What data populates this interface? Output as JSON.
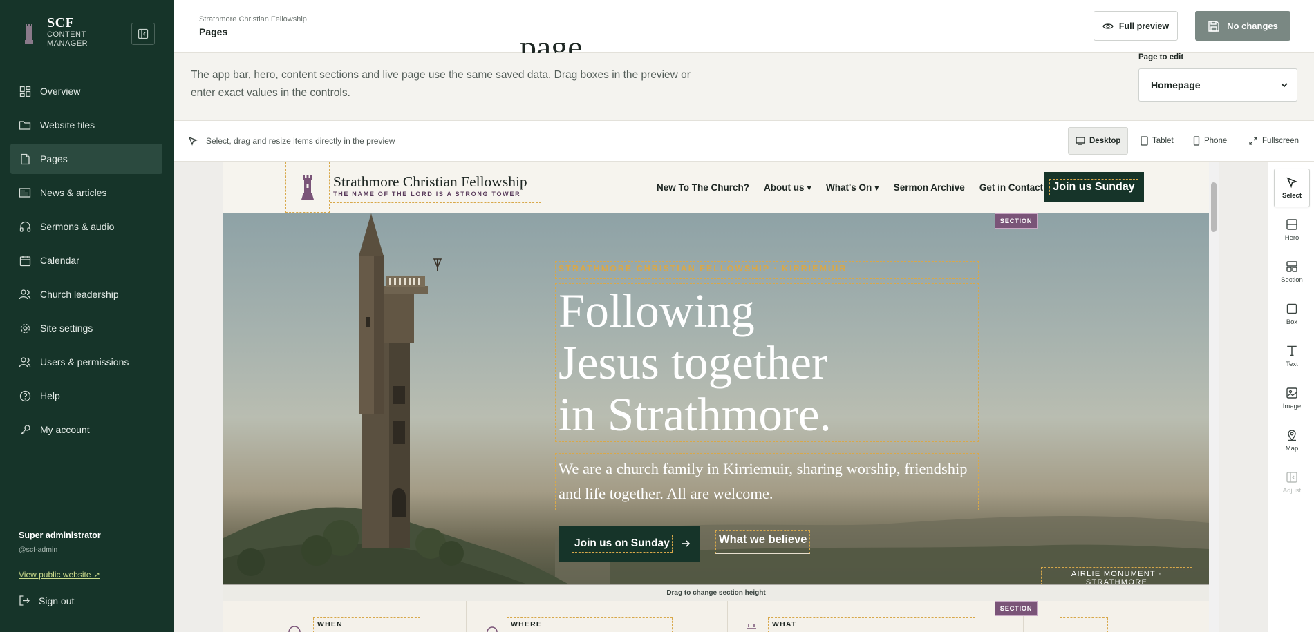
{
  "sidebar": {
    "brand_title": "SCF",
    "brand_sub1": "CONTENT",
    "brand_sub2": "MANAGER",
    "items": [
      {
        "label": "Overview",
        "icon": "dashboard-icon"
      },
      {
        "label": "Website files",
        "icon": "folder-icon"
      },
      {
        "label": "Pages",
        "icon": "file-icon",
        "active": true
      },
      {
        "label": "News & articles",
        "icon": "newspaper-icon"
      },
      {
        "label": "Sermons & audio",
        "icon": "headphones-icon"
      },
      {
        "label": "Calendar",
        "icon": "calendar-icon"
      },
      {
        "label": "Church leadership",
        "icon": "users-icon"
      },
      {
        "label": "Site settings",
        "icon": "gear-icon"
      },
      {
        "label": "Users & permissions",
        "icon": "user-group-icon"
      },
      {
        "label": "Help",
        "icon": "help-icon"
      },
      {
        "label": "My account",
        "icon": "key-icon"
      }
    ],
    "user_role": "Super administrator",
    "user_handle": "@scf-admin",
    "public_link": "View public website ↗",
    "sign_out": "Sign out"
  },
  "topbar": {
    "breadcrumb": "Strathmore Christian Fellowship",
    "title": "Pages",
    "ghost_heading": "page",
    "full_preview": "Full preview",
    "no_changes": "No changes"
  },
  "intro": {
    "text": "The app bar, hero, content sections and live page use the same saved data. Drag boxes in the preview or enter exact values in the controls.",
    "page_label": "Page to edit",
    "page_value": "Homepage"
  },
  "toolbar": {
    "hint": "Select, drag and resize items directly in the preview",
    "devices": [
      "Desktop",
      "Tablet",
      "Phone",
      "Fullscreen"
    ],
    "active_device": "Desktop"
  },
  "rail": {
    "tools": [
      {
        "label": "Select",
        "icon": "cursor-icon",
        "state": "active"
      },
      {
        "label": "Hero",
        "icon": "hero-block-icon",
        "state": "normal"
      },
      {
        "label": "Section",
        "icon": "section-block-icon",
        "state": "normal"
      },
      {
        "label": "Box",
        "icon": "box-icon",
        "state": "normal"
      },
      {
        "label": "Text",
        "icon": "text-icon",
        "state": "normal"
      },
      {
        "label": "Image",
        "icon": "image-icon",
        "state": "normal"
      },
      {
        "label": "Map",
        "icon": "map-pin-icon",
        "state": "normal"
      },
      {
        "label": "Adjust",
        "icon": "adjust-icon",
        "state": "disabled"
      }
    ]
  },
  "preview": {
    "site_name": "Strathmore Christian Fellowship",
    "site_motto": "THE NAME OF THE LORD IS A STRONG TOWER",
    "nav": [
      "New To The Church?",
      "About us ▾",
      "What's On ▾",
      "Sermon Archive",
      "Get in Contact"
    ],
    "cta": "Join us Sunday",
    "section_badge": "SECTION",
    "eyebrow": "STRATHMORE CHRISTIAN FELLOWSHIP · KIRRIEMUIR",
    "headline": [
      "Following",
      "Jesus together",
      "in Strathmore."
    ],
    "lede": "We are a church family in Kirriemuir, sharing worship, friendship and life together. All are welcome.",
    "primary_button": "Join us on Sunday",
    "secondary_button": "What we believe",
    "image_caption": "AIRLIE MONUMENT · STRATHMORE",
    "drag_hint": "Drag to change section height",
    "info_labels": [
      "WHEN",
      "WHERE",
      "WHAT",
      ""
    ]
  },
  "colors": {
    "sidebar_bg": "#163429",
    "accent_dash": "#d8a84a",
    "badge": "#7a5478",
    "primary": "#163429"
  }
}
